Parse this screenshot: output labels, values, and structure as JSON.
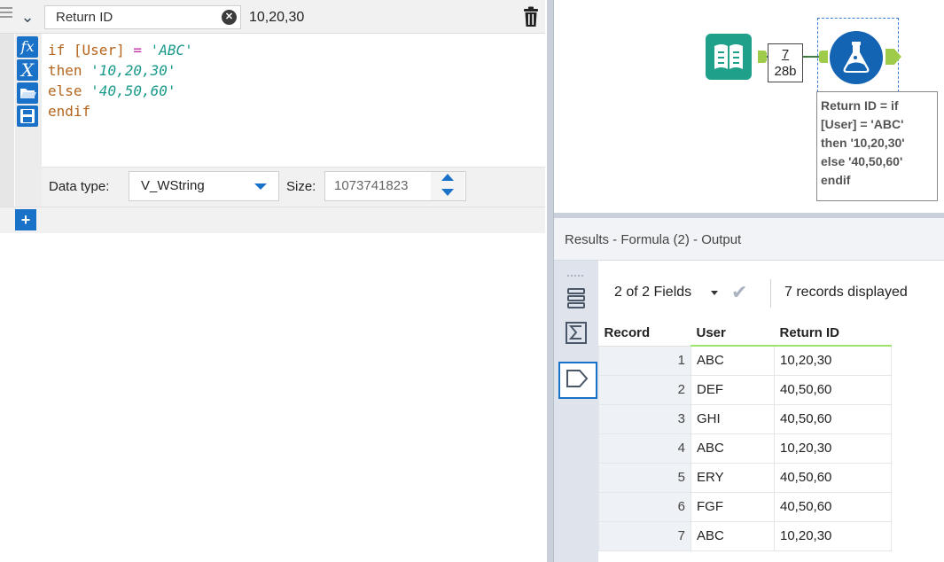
{
  "formula": {
    "field_name": "Return ID",
    "preview_value": "10,20,30",
    "expression_lines": [
      {
        "parts": [
          {
            "t": "if ",
            "c": "kw"
          },
          {
            "t": "[User]",
            "c": "fld"
          },
          {
            "t": " = ",
            "c": "op"
          },
          {
            "t": "'ABC'",
            "c": "str"
          }
        ]
      },
      {
        "parts": [
          {
            "t": "then ",
            "c": "kw"
          },
          {
            "t": "'10,20,30'",
            "c": "str"
          }
        ]
      },
      {
        "parts": [
          {
            "t": "else ",
            "c": "kw"
          },
          {
            "t": "'40,50,60'",
            "c": "str"
          }
        ]
      },
      {
        "parts": [
          {
            "t": "endif",
            "c": "kw"
          }
        ]
      }
    ],
    "data_type_label": "Data type:",
    "data_type_value": "V_WString",
    "size_label": "Size:",
    "size_value": "1073741823"
  },
  "canvas": {
    "record_count": "7",
    "record_size": "28b",
    "annotation_lines": [
      "Return ID = if",
      "[User] = 'ABC'",
      "then '10,20,30'",
      "else '40,50,60'",
      "endif"
    ]
  },
  "results": {
    "title": "Results - Formula (2) - Output",
    "fields_selector": "2 of 2 Fields",
    "records_displayed": "7 records displayed",
    "columns": [
      "Record",
      "User",
      "Return ID"
    ],
    "rows": [
      {
        "record": "1",
        "user": "ABC",
        "return_id": "10,20,30"
      },
      {
        "record": "2",
        "user": "DEF",
        "return_id": "40,50,60"
      },
      {
        "record": "3",
        "user": "GHI",
        "return_id": "40,50,60"
      },
      {
        "record": "4",
        "user": "ABC",
        "return_id": "10,20,30"
      },
      {
        "record": "5",
        "user": "ERY",
        "return_id": "40,50,60"
      },
      {
        "record": "6",
        "user": "FGF",
        "return_id": "40,50,60"
      },
      {
        "record": "7",
        "user": "ABC",
        "return_id": "10,20,30"
      }
    ]
  },
  "icons": {
    "formula_tool": "flask-icon",
    "input_tool": "book-icon",
    "delete": "trash-icon",
    "clear": "clear-x-icon"
  },
  "colors": {
    "accent": "#1a72c8",
    "input_tool": "#1fa08a",
    "anchor": "#9ecc4a",
    "header_underline": "#9ee36b"
  }
}
